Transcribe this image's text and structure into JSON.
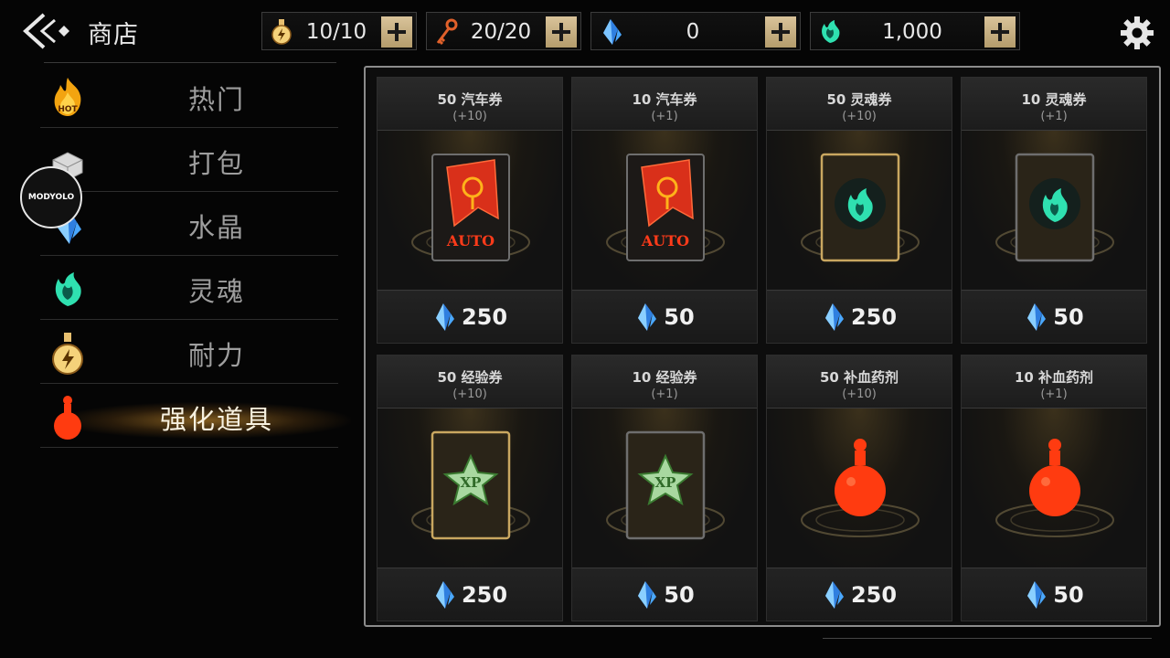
{
  "header": {
    "title": "商店",
    "back_icon": "back-arrow-icon",
    "settings_icon": "gear-icon"
  },
  "resources": [
    {
      "name": "stamina",
      "icon": "stamina-potion-icon",
      "value": "10/10"
    },
    {
      "name": "keys",
      "icon": "key-icon",
      "value": "20/20"
    },
    {
      "name": "crystal",
      "icon": "crystal-icon",
      "value": "0"
    },
    {
      "name": "soul",
      "icon": "soul-icon",
      "value": "1,000"
    }
  ],
  "sidebar": {
    "items": [
      {
        "label": "热门",
        "icon": "hot-flame-icon",
        "active": false
      },
      {
        "label": "打包",
        "icon": "package-icon",
        "active": false
      },
      {
        "label": "水晶",
        "icon": "crystal-icon",
        "active": false
      },
      {
        "label": "灵魂",
        "icon": "soul-icon",
        "active": false
      },
      {
        "label": "耐力",
        "icon": "stamina-potion-icon",
        "active": false
      },
      {
        "label": "强化道具",
        "icon": "red-potion-icon",
        "active": true
      }
    ],
    "watermark": "MODYOLO"
  },
  "products": [
    {
      "name": "50 汽车券",
      "bonus": "(+10)",
      "price": "250",
      "art": "auto-ticket",
      "gold_frame": false,
      "art_label": "AUTO"
    },
    {
      "name": "10 汽车券",
      "bonus": "(+1)",
      "price": "50",
      "art": "auto-ticket",
      "gold_frame": false,
      "art_label": "AUTO"
    },
    {
      "name": "50 灵魂券",
      "bonus": "(+10)",
      "price": "250",
      "art": "soul-ticket",
      "gold_frame": true,
      "art_label": ""
    },
    {
      "name": "10 灵魂券",
      "bonus": "(+1)",
      "price": "50",
      "art": "soul-ticket",
      "gold_frame": false,
      "art_label": ""
    },
    {
      "name": "50 经验券",
      "bonus": "(+10)",
      "price": "250",
      "art": "xp-ticket",
      "gold_frame": true,
      "art_label": "XP"
    },
    {
      "name": "10 经验券",
      "bonus": "(+1)",
      "price": "50",
      "art": "xp-ticket",
      "gold_frame": false,
      "art_label": "XP"
    },
    {
      "name": "50 补血药剂",
      "bonus": "(+10)",
      "price": "250",
      "art": "health-potion",
      "gold_frame": false,
      "art_label": ""
    },
    {
      "name": "10 补血药剂",
      "bonus": "(+1)",
      "price": "50",
      "art": "health-potion",
      "gold_frame": false,
      "art_label": ""
    }
  ],
  "colors": {
    "crystal": "#4aa8ff",
    "soul": "#2fe0b0",
    "potion_red": "#ff3b10",
    "plus_button": "#cbb283",
    "active_glow": "#b07a28"
  }
}
